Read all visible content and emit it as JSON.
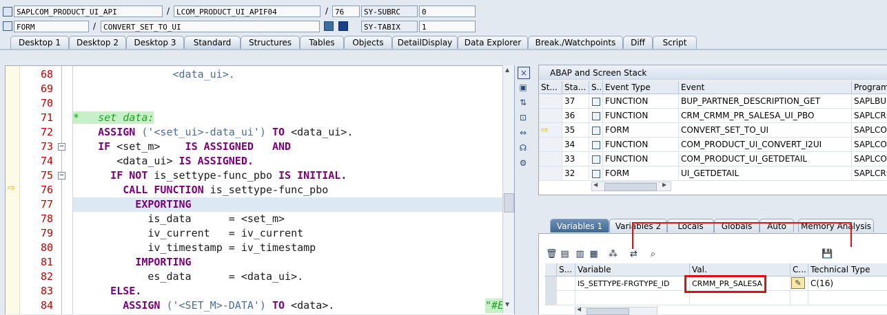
{
  "header": {
    "program": "SAPLCOM_PRODUCT_UI_API",
    "include": "LCOM_PRODUCT_UI_APIF04",
    "line": "76",
    "sy_subrc_label": "SY-SUBRC",
    "sy_subrc_value": "0",
    "event_type": "FORM",
    "event": "CONVERT_SET_TO_UI",
    "sy_tabix_label": "SY-TABIX",
    "sy_tabix_value": "1",
    "slash": "/"
  },
  "tabs": [
    "Desktop 1",
    "Desktop 2",
    "Desktop 3",
    "Standard",
    "Structures",
    "Tables",
    "Objects",
    "DetailDisplay",
    "Data Explorer",
    "Break./Watchpoints",
    "Diff",
    "Script"
  ],
  "active_tab": "Standard",
  "code": {
    "lines": [
      {
        "n": "68",
        "t": "                <data_ui>."
      },
      {
        "n": "69",
        "t": ""
      },
      {
        "n": "70",
        "t": ""
      },
      {
        "n": "71",
        "t": "*   set data:"
      },
      {
        "n": "72",
        "t": "    ASSIGN ('<set_ui>-data_ui') TO <data_ui>."
      },
      {
        "n": "73",
        "t": "    IF <set_m>    IS ASSIGNED   AND"
      },
      {
        "n": "74",
        "t": "       <data_ui> IS ASSIGNED."
      },
      {
        "n": "75",
        "t": "      IF NOT is_settype-func_pbo IS INITIAL."
      },
      {
        "n": "76",
        "t": "        CALL FUNCTION is_settype-func_pbo"
      },
      {
        "n": "77",
        "t": "          EXPORTING"
      },
      {
        "n": "78",
        "t": "            is_data      = <set_m>"
      },
      {
        "n": "79",
        "t": "            iv_current   = iv_current"
      },
      {
        "n": "80",
        "t": "            iv_timestamp = iv_timestamp"
      },
      {
        "n": "81",
        "t": "          IMPORTING"
      },
      {
        "n": "82",
        "t": "            es_data      = <data_ui>."
      },
      {
        "n": "83",
        "t": "      ELSE."
      },
      {
        "n": "84",
        "t": "        ASSIGN ('<SET_M>-DATA') TO <data>."
      }
    ],
    "trailing_comment": "\"#E"
  },
  "stack": {
    "title": "ABAP and Screen Stack",
    "columns": [
      "St...",
      "Sta...",
      "S...",
      "Event Type",
      "Event",
      "Program"
    ],
    "rows": [
      {
        "level": "37",
        "type": "FUNCTION",
        "event": "BUP_PARTNER_DESCRIPTION_GET",
        "program": "SAPLBUD"
      },
      {
        "level": "36",
        "type": "FUNCTION",
        "event": "CRM_CRMM_PR_SALESA_UI_PBO",
        "program": "SAPLCRM"
      },
      {
        "level": "35",
        "type": "FORM",
        "event": "CONVERT_SET_TO_UI",
        "program": "SAPLCOM"
      },
      {
        "level": "34",
        "type": "FUNCTION",
        "event": "COM_PRODUCT_UI_CONVERT_I2UI",
        "program": "SAPLCOM"
      },
      {
        "level": "33",
        "type": "FUNCTION",
        "event": "COM_PRODUCT_UI_GETDETAIL",
        "program": "SAPLCOM"
      },
      {
        "level": "32",
        "type": "FORM",
        "event": "UI_GETDETAIL",
        "program": "SAPLCRM"
      }
    ]
  },
  "var_tabs": [
    "Variables 1",
    "Variables 2",
    "Locals",
    "Globals",
    "Auto",
    "Memory Analysis"
  ],
  "active_var_tab": "Variables 1",
  "variables": {
    "columns": [
      "S...",
      "Variable",
      "Val.",
      "C...",
      "Technical Type"
    ],
    "rows": [
      {
        "variable": "IS_SETTYPE-FRGTYPE_ID",
        "value": "CRMM_PR_SALESA",
        "type": "C(16)"
      }
    ]
  },
  "colors": {
    "keyword": "#7a007a",
    "string": "#4c6d96",
    "comment": "#22a022",
    "line_number": "#c00000",
    "highlight": "#e01010"
  }
}
